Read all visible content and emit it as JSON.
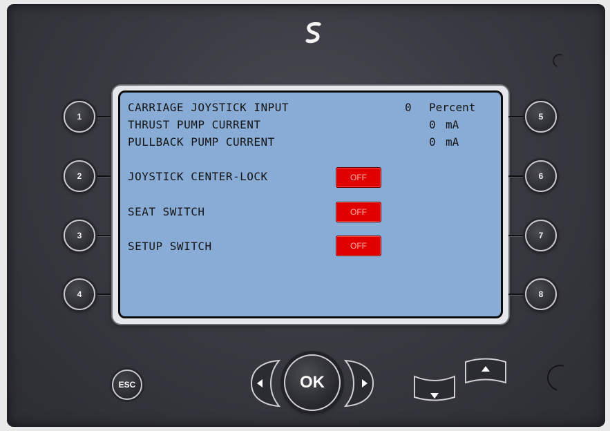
{
  "screen": {
    "rows": [
      {
        "label": "CARRIAGE JOYSTICK INPUT",
        "value": "0",
        "unit": "Percent"
      },
      {
        "label": "THRUST PUMP CURRENT",
        "value": "0",
        "unit": "mA"
      },
      {
        "label": "PULLBACK PUMP CURRENT",
        "value": "0",
        "unit": "mA"
      }
    ],
    "switches": [
      {
        "label": "JOYSTICK CENTER-LOCK",
        "state": "OFF"
      },
      {
        "label": "SEAT SWITCH",
        "state": "OFF"
      },
      {
        "label": "SETUP SWITCH",
        "state": "OFF"
      }
    ],
    "status_color_off": "#e10000"
  },
  "softkeys": {
    "left": [
      "1",
      "2",
      "3",
      "4"
    ],
    "right": [
      "5",
      "6",
      "7",
      "8"
    ]
  },
  "controls": {
    "esc_label": "ESC",
    "ok_label": "OK",
    "icons": [
      "brand-logo-icon",
      "arrow-left-icon",
      "arrow-right-icon",
      "arrow-down-icon",
      "arrow-up-icon"
    ]
  }
}
